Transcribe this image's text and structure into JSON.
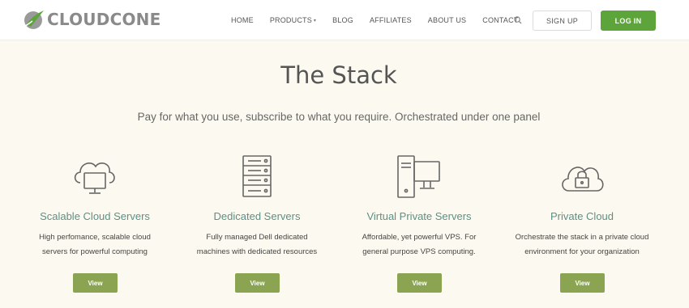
{
  "header": {
    "logo": {
      "text_cloud": "CLOUD",
      "text_cone": "CONE"
    },
    "nav": [
      {
        "label": "HOME"
      },
      {
        "label": "PRODUCTS",
        "has_dropdown": true
      },
      {
        "label": "BLOG"
      },
      {
        "label": "AFFILIATES"
      },
      {
        "label": "ABOUT US"
      },
      {
        "label": "CONTACT"
      }
    ],
    "search_icon": "search-icon",
    "signup_label": "SIGN UP",
    "login_label": "LOG IN"
  },
  "hero": {
    "title": "The Stack",
    "subtitle": "Pay for what you use, subscribe to what you require. Orchestrated under one panel"
  },
  "cards": [
    {
      "icon": "cloud-monitor-icon",
      "title": "Scalable Cloud Servers",
      "desc_line1": "High perfomance, scalable cloud",
      "desc_line2": "servers for powerful computing",
      "button": "View"
    },
    {
      "icon": "server-rack-icon",
      "title": "Dedicated Servers",
      "desc_line1": "Fully managed Dell dedicated",
      "desc_line2": "machines with dedicated resources",
      "button": "View"
    },
    {
      "icon": "desktop-tower-icon",
      "title": "Virtual Private Servers",
      "desc_line1": "Affordable, yet powerful VPS. For",
      "desc_line2": "general purpose VPS computing.",
      "button": "View"
    },
    {
      "icon": "cloud-lock-icon",
      "title": "Private Cloud",
      "desc_line1": "Orchestrate the stack in a private cloud",
      "desc_line2": "environment for your organization",
      "button": "View"
    }
  ],
  "colors": {
    "background": "#fcfaf0",
    "login_green": "#5da43b",
    "view_button": "#8aa451",
    "card_title": "#5d8f86",
    "logo_green": "#5da43b"
  }
}
